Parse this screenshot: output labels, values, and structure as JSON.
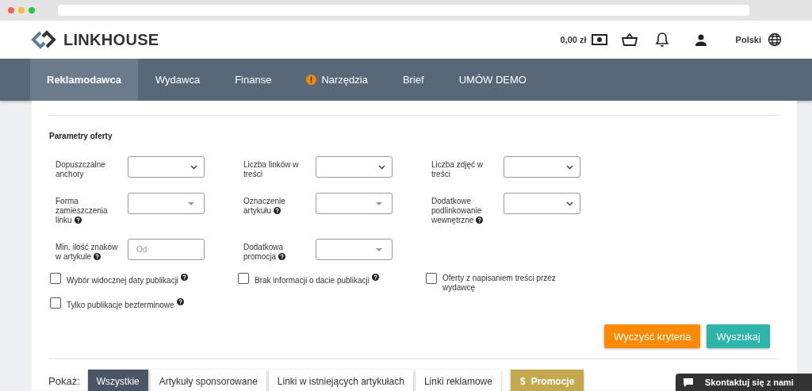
{
  "header": {
    "logo": "LINKHOUSE",
    "balance": "0,00 zł",
    "language": "Polski"
  },
  "nav": [
    {
      "label": "Reklamodawca",
      "selected": true,
      "alert": false
    },
    {
      "label": "Wydawca",
      "selected": false,
      "alert": false
    },
    {
      "label": "Finanse",
      "selected": false,
      "alert": false
    },
    {
      "label": "Narzędzia",
      "selected": false,
      "alert": true
    },
    {
      "label": "Brief",
      "selected": false,
      "alert": false
    },
    {
      "label": "UMÓW DEMO",
      "selected": false,
      "alert": false
    }
  ],
  "filters": {
    "title": "Parametry oferty",
    "fields": [
      {
        "label": "Dopuszczalne anchory",
        "kind": "select",
        "help": false
      },
      {
        "label": "Liczba linków w treści",
        "kind": "select",
        "help": false
      },
      {
        "label": "Liczba zdjęć w treści",
        "kind": "select",
        "help": false
      },
      {
        "label": "Forma zamieszczenia linku",
        "kind": "combo",
        "help": true
      },
      {
        "label": "Oznaczenie artykułu",
        "kind": "combo",
        "help": true
      },
      {
        "label": "Dodatkowe podlinkowanie wewnętrzne",
        "kind": "select",
        "help": true
      },
      {
        "label": "Min. ilość znaków w artykule",
        "kind": "input",
        "placeholder": "Od",
        "help": true
      },
      {
        "label": "Dodatkowa promocja",
        "kind": "combo",
        "help": true
      }
    ],
    "checkboxes": [
      {
        "label": "Wybór widocznej daty publikacji",
        "checked": false,
        "help": true
      },
      {
        "label": "Brak informacji o dacie publikacji",
        "checked": false,
        "help": true
      },
      {
        "label": "Oferty z napisaniem treści przez wydawcę",
        "checked": false,
        "help": false
      },
      {
        "label": "Tylko publikacje bezterminowe",
        "checked": false,
        "help": true
      }
    ],
    "buttons": [
      {
        "label": "Wyczyść kryteria",
        "kind": "clear"
      },
      {
        "label": "Wyszukaj",
        "kind": "search"
      }
    ]
  },
  "show": {
    "label": "Pokaż:",
    "options": [
      {
        "label": "Wszystkie",
        "selected": true,
        "kind": "plain"
      },
      {
        "label": "Artykuły sponsorowane",
        "selected": false,
        "kind": "plain"
      },
      {
        "label": "Linki w istniejących artykułach",
        "selected": false,
        "kind": "plain"
      },
      {
        "label": "Linki reklamowe",
        "selected": false,
        "kind": "plain"
      },
      {
        "label": "Promocje",
        "selected": false,
        "kind": "promo",
        "icon_text": "$"
      }
    ]
  },
  "chat": {
    "label": "Skontaktuj się z nami"
  }
}
